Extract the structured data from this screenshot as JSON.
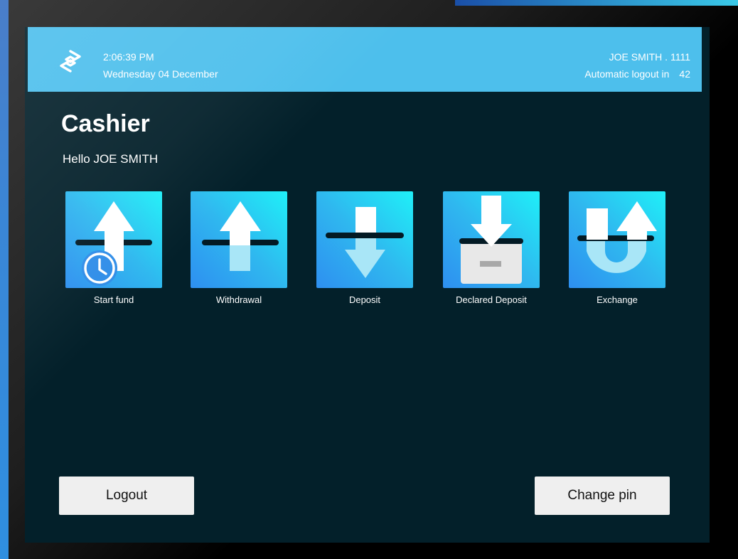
{
  "header": {
    "logo_icon": "stack-s-logo-icon",
    "time": "2:06:39 PM",
    "date": "Wednesday 04 December",
    "user": "JOE SMITH . 1111",
    "logout_label": "Automatic logout in",
    "logout_count": "42"
  },
  "main": {
    "title": "Cashier",
    "greeting": "Hello JOE SMITH"
  },
  "tiles": [
    {
      "label": "Start fund",
      "icon": "start-fund-icon"
    },
    {
      "label": "Withdrawal",
      "icon": "withdrawal-icon"
    },
    {
      "label": "Deposit",
      "icon": "deposit-icon"
    },
    {
      "label": "Declared Deposit",
      "icon": "declared-deposit-icon"
    },
    {
      "label": "Exchange",
      "icon": "exchange-icon"
    }
  ],
  "footer": {
    "logout_label": "Logout",
    "change_pin_label": "Change pin"
  },
  "colors": {
    "header_bg": "#4dbfec",
    "screen_bg": "#03202a",
    "tile_gradient_start": "#2e8ff0",
    "tile_gradient_end": "#1ff0f8",
    "button_bg": "#efefef"
  }
}
